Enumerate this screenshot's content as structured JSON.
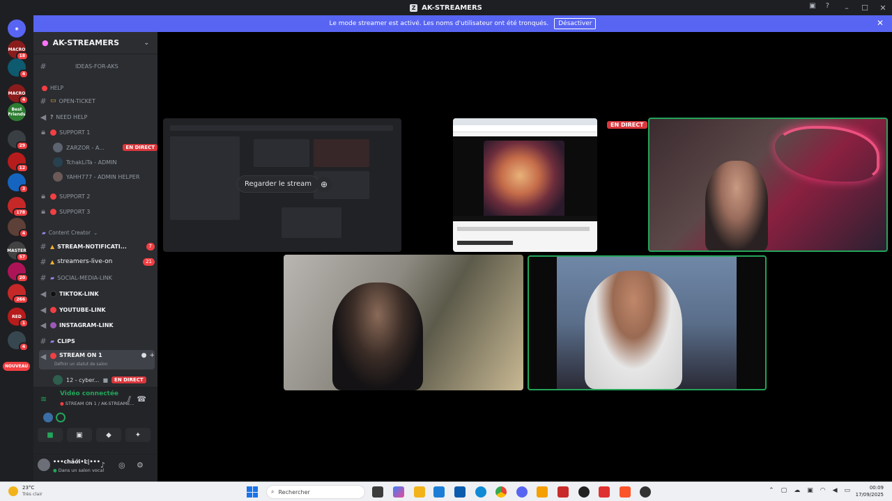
{
  "window": {
    "title": "AK-STREAMERS"
  },
  "banner": {
    "text": "Le mode streamer est activé. Les noms d'utilisateur ont été tronqués.",
    "button": "Désactiver"
  },
  "servers": [
    {
      "label": "MACRO",
      "badge": "18",
      "color": "#8a1c1c"
    },
    {
      "label": "",
      "badge": "4",
      "color": "#0e5a6e"
    },
    {
      "label": "MACRO",
      "badge": "4",
      "color": "#8a1c1c"
    },
    {
      "label": "Best Friends",
      "badge": "",
      "color": "#2e7d32"
    },
    {
      "label": "",
      "badge": "29",
      "color": "#3a3f44"
    },
    {
      "label": "",
      "badge": "12",
      "color": "#b71c1c"
    },
    {
      "label": "",
      "badge": "3",
      "color": "#1565c0"
    },
    {
      "label": "",
      "badge": "178",
      "color": "#c62828"
    },
    {
      "label": "",
      "badge": "4",
      "color": "#5d4037"
    },
    {
      "label": "MASTER",
      "badge": "57",
      "color": "#424242"
    },
    {
      "label": "",
      "badge": "20",
      "color": "#ad1457"
    },
    {
      "label": "",
      "badge": "266",
      "color": "#c62828"
    },
    {
      "label": "RED",
      "badge": "1",
      "color": "#b71c1c"
    },
    {
      "label": "",
      "badge": "4",
      "color": "#37474f"
    }
  ],
  "new_label": "NOUVEAU",
  "guild": {
    "name": "AK-STREAMERS"
  },
  "channels": {
    "ideas": "IDEAS-FOR-AKS",
    "help_category": "HELP",
    "open_ticket": "OPEN-TICKET",
    "need_help": "NEED HELP",
    "support1": "SUPPORT 1",
    "support2": "SUPPORT 2",
    "support3": "SUPPORT 3",
    "content_category": "Content Creator",
    "stream_notif": "STREAM-NOTIFICATI...",
    "stream_notif_count": "7",
    "streamers_live": "streamers-live-on",
    "streamers_live_count": "21",
    "social": "SOCIAL-MEDIA-LINK",
    "tiktok": "TIKTOK-LINK",
    "youtube": "YOUTUBE-LINK",
    "instagram": "INSTAGRAM-LINK",
    "clips": "CLIPS",
    "stream_on": "STREAM ON 1",
    "status_hint": "Définir un statut de salon"
  },
  "voice_users": {
    "u1": "ZARZOR - A...",
    "u2": "TchakLiTa - ADMIN",
    "u3": "YAHH777 - ADMIN HELPER",
    "u4": "12 - cyber..."
  },
  "live_label": "EN DIRECT",
  "voice": {
    "status": "Vidéo connectée",
    "channel": "STREAM ON 1 / AK-STREAME..."
  },
  "user": {
    "name": "•••chảới•Ŀ|•••",
    "status": "Dans un salon vocal"
  },
  "stage": {
    "watch_button": "Regarder le stream",
    "live_badge": "EN DIRECT"
  },
  "taskbar": {
    "weather_temp": "23°C",
    "weather_desc": "Très clair",
    "search": "Rechercher",
    "time": "00:09",
    "date": "17/09/2025"
  }
}
